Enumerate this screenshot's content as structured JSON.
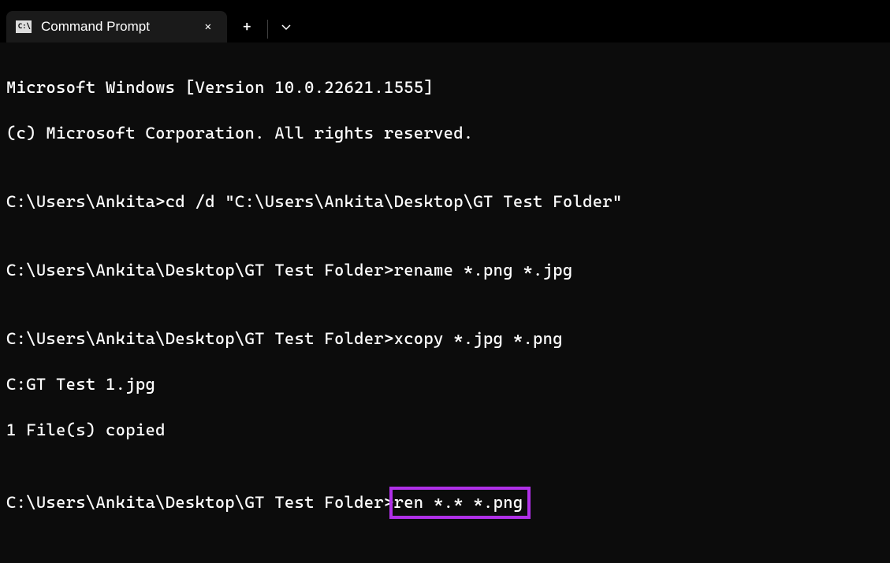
{
  "titlebar": {
    "tab_title": "Command Prompt",
    "close_label": "✕",
    "new_tab_label": "+",
    "dropdown_label": "⌄"
  },
  "terminal": {
    "line1": "Microsoft Windows [Version 10.0.22621.1555]",
    "line2": "(c) Microsoft Corporation. All rights reserved.",
    "blank1": "",
    "line3_prompt": "C:\\Users\\Ankita>",
    "line3_cmd": "cd /d \"C:\\Users\\Ankita\\Desktop\\GT Test Folder\"",
    "blank2": "",
    "line4_prompt": "C:\\Users\\Ankita\\Desktop\\GT Test Folder>",
    "line4_cmd": "rename *.png *.jpg",
    "blank3": "",
    "line5_prompt": "C:\\Users\\Ankita\\Desktop\\GT Test Folder>",
    "line5_cmd": "xcopy *.jpg *.png",
    "line6": "C:GT Test 1.jpg",
    "line7": "1 File(s) copied",
    "blank4": "",
    "line8_prompt": "C:\\Users\\Ankita\\Desktop\\GT Test Folder>",
    "line8_cmd": "ren *.* *.png"
  }
}
